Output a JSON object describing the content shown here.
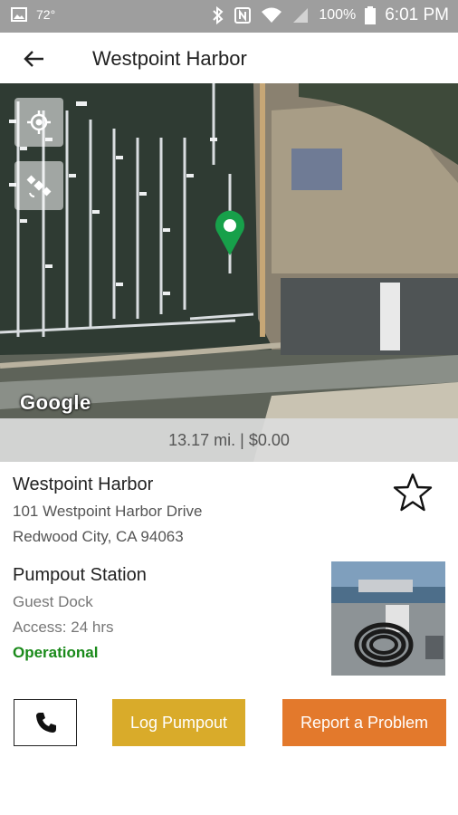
{
  "status_bar": {
    "temperature": "72°",
    "battery": "100%",
    "time": "6:01 PM"
  },
  "app_bar": {
    "title": "Westpoint Harbor"
  },
  "map": {
    "attribution": "Google",
    "distance_price": "13.17 mi. | $0.00"
  },
  "location": {
    "name": "Westpoint Harbor",
    "address_line1": "101 Westpoint Harbor Drive",
    "address_line2": "Redwood City, CA 94063"
  },
  "station": {
    "title": "Pumpout Station",
    "dock": "Guest Dock",
    "access": "Access: 24 hrs",
    "status": "Operational"
  },
  "actions": {
    "log_label": "Log Pumpout",
    "report_label": "Report a Problem"
  },
  "colors": {
    "status_operational": "#1a8a1a",
    "log_button": "#d9ab2a",
    "report_button": "#e3792c",
    "map_pin": "#17a04a"
  },
  "icons": [
    "image-icon",
    "bluetooth-icon",
    "nfc-icon",
    "wifi-icon",
    "signal-icon",
    "battery-icon",
    "back-arrow-icon",
    "my-location-icon",
    "satellite-icon",
    "map-pin-icon",
    "star-outline-icon",
    "phone-icon"
  ]
}
